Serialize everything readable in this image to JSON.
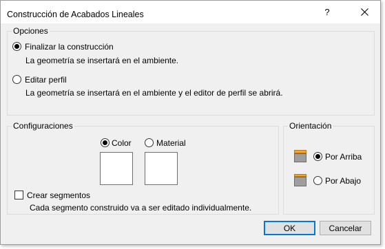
{
  "window": {
    "title": "Construcción de Acabados Lineales",
    "help_label": "?"
  },
  "opciones": {
    "legend": "Opciones",
    "finalizar": {
      "label": "Finalizar la construcción",
      "description": "La geometría se insertará en el ambiente.",
      "checked": true
    },
    "editar": {
      "label": "Editar perfil",
      "description": "La geometría se insertará en el ambiente y el editor de perfil se abrirá.",
      "checked": false
    }
  },
  "configuraciones": {
    "legend": "Configuraciones",
    "color_label": "Color",
    "material_label": "Material",
    "crear_segmentos_label": "Crear segmentos",
    "crear_segmentos_description": "Cada segmento construido va a ser editado individualmente."
  },
  "orientacion": {
    "legend": "Orientación",
    "por_arriba_label": "Por Arriba",
    "por_abajo_label": "Por Abajo"
  },
  "buttons": {
    "ok_label": "OK",
    "cancel_label": "Cancelar"
  },
  "colors": {
    "accent": "#0078d7",
    "icon_orange": "#f5a623",
    "icon_gray": "#9e9e9e"
  }
}
